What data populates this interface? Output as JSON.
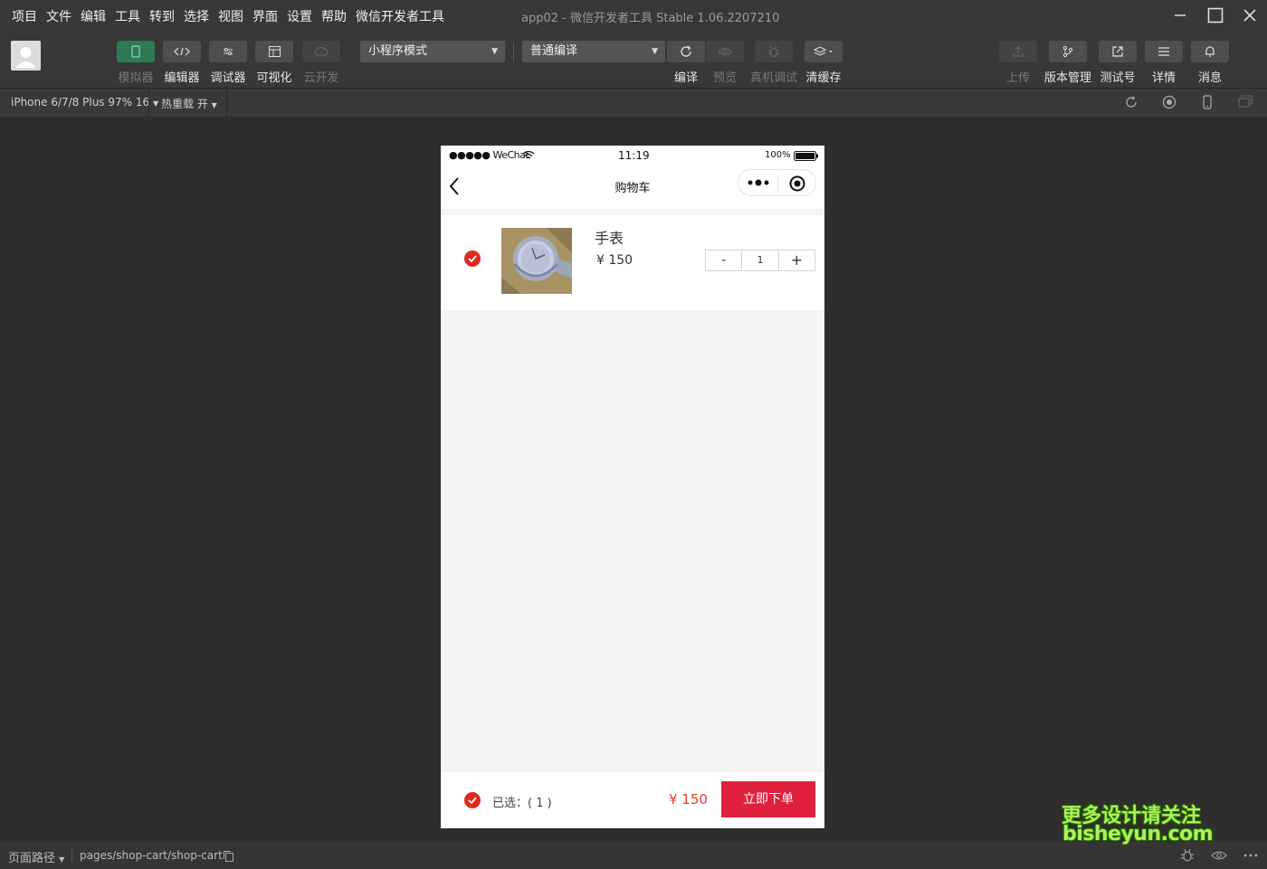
{
  "menu": [
    "项目",
    "文件",
    "编辑",
    "工具",
    "转到",
    "选择",
    "视图",
    "界面",
    "设置",
    "帮助",
    "微信开发者工具"
  ],
  "window_title": "app02 - 微信开发者工具 Stable 1.06.2207210",
  "toolbar": {
    "simulator": "模拟器",
    "editor": "编辑器",
    "debugger": "调试器",
    "visual": "可视化",
    "cloud": "云开发",
    "mode_select": "小程序模式",
    "compile_select": "普通编译",
    "compile": "编译",
    "preview": "预览",
    "real_debug": "真机调试",
    "clear_cache": "清缓存",
    "upload": "上传",
    "version": "版本管理",
    "test_account": "测试号",
    "details": "详情",
    "messages": "消息"
  },
  "subbar": {
    "device": "iPhone 6/7/8 Plus 97% 16",
    "hot_reload": "热重载 开"
  },
  "phone": {
    "carrier": "●●●●● WeChat",
    "time": "11:19",
    "battery": "100%",
    "nav_title": "购物车",
    "item": {
      "name": "手表",
      "price": "¥ 150",
      "qty": "1",
      "minus": "-",
      "plus": "+"
    },
    "footer": {
      "selected": "已选：( 1 )",
      "total": "¥ 150",
      "order_button": "立即下单"
    }
  },
  "bottombar": {
    "path_label": "页面路径",
    "path": "pages/shop-cart/shop-cart"
  },
  "watermark": {
    "line1": "更多设计请关注",
    "line2": "bisheyun.com"
  },
  "colors": {
    "accent_red": "#e02a20",
    "order_button": "#e0213e",
    "simulator_active": "#2f7a55",
    "watermark_green": "#a8f35a"
  }
}
